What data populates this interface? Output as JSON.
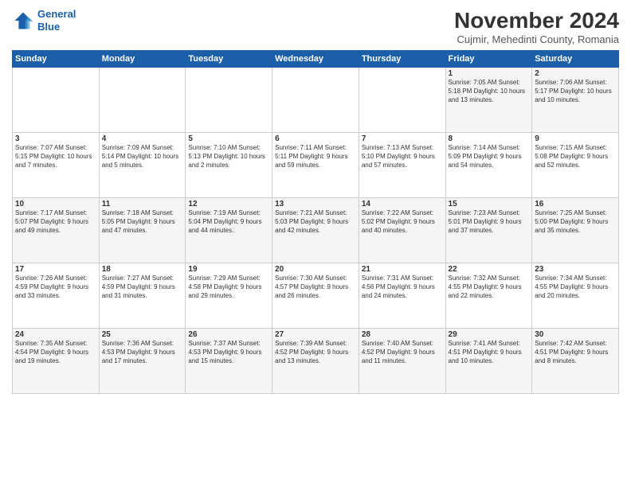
{
  "header": {
    "logo_line1": "General",
    "logo_line2": "Blue",
    "month": "November 2024",
    "location": "Cujmir, Mehedinti County, Romania"
  },
  "weekdays": [
    "Sunday",
    "Monday",
    "Tuesday",
    "Wednesday",
    "Thursday",
    "Friday",
    "Saturday"
  ],
  "weeks": [
    [
      {
        "day": "",
        "text": ""
      },
      {
        "day": "",
        "text": ""
      },
      {
        "day": "",
        "text": ""
      },
      {
        "day": "",
        "text": ""
      },
      {
        "day": "",
        "text": ""
      },
      {
        "day": "1",
        "text": "Sunrise: 7:05 AM\nSunset: 5:18 PM\nDaylight: 10 hours\nand 13 minutes."
      },
      {
        "day": "2",
        "text": "Sunrise: 7:06 AM\nSunset: 5:17 PM\nDaylight: 10 hours\nand 10 minutes."
      }
    ],
    [
      {
        "day": "3",
        "text": "Sunrise: 7:07 AM\nSunset: 5:15 PM\nDaylight: 10 hours\nand 7 minutes."
      },
      {
        "day": "4",
        "text": "Sunrise: 7:09 AM\nSunset: 5:14 PM\nDaylight: 10 hours\nand 5 minutes."
      },
      {
        "day": "5",
        "text": "Sunrise: 7:10 AM\nSunset: 5:13 PM\nDaylight: 10 hours\nand 2 minutes."
      },
      {
        "day": "6",
        "text": "Sunrise: 7:11 AM\nSunset: 5:11 PM\nDaylight: 9 hours\nand 59 minutes."
      },
      {
        "day": "7",
        "text": "Sunrise: 7:13 AM\nSunset: 5:10 PM\nDaylight: 9 hours\nand 57 minutes."
      },
      {
        "day": "8",
        "text": "Sunrise: 7:14 AM\nSunset: 5:09 PM\nDaylight: 9 hours\nand 54 minutes."
      },
      {
        "day": "9",
        "text": "Sunrise: 7:15 AM\nSunset: 5:08 PM\nDaylight: 9 hours\nand 52 minutes."
      }
    ],
    [
      {
        "day": "10",
        "text": "Sunrise: 7:17 AM\nSunset: 5:07 PM\nDaylight: 9 hours\nand 49 minutes."
      },
      {
        "day": "11",
        "text": "Sunrise: 7:18 AM\nSunset: 5:05 PM\nDaylight: 9 hours\nand 47 minutes."
      },
      {
        "day": "12",
        "text": "Sunrise: 7:19 AM\nSunset: 5:04 PM\nDaylight: 9 hours\nand 44 minutes."
      },
      {
        "day": "13",
        "text": "Sunrise: 7:21 AM\nSunset: 5:03 PM\nDaylight: 9 hours\nand 42 minutes."
      },
      {
        "day": "14",
        "text": "Sunrise: 7:22 AM\nSunset: 5:02 PM\nDaylight: 9 hours\nand 40 minutes."
      },
      {
        "day": "15",
        "text": "Sunrise: 7:23 AM\nSunset: 5:01 PM\nDaylight: 9 hours\nand 37 minutes."
      },
      {
        "day": "16",
        "text": "Sunrise: 7:25 AM\nSunset: 5:00 PM\nDaylight: 9 hours\nand 35 minutes."
      }
    ],
    [
      {
        "day": "17",
        "text": "Sunrise: 7:26 AM\nSunset: 4:59 PM\nDaylight: 9 hours\nand 33 minutes."
      },
      {
        "day": "18",
        "text": "Sunrise: 7:27 AM\nSunset: 4:59 PM\nDaylight: 9 hours\nand 31 minutes."
      },
      {
        "day": "19",
        "text": "Sunrise: 7:29 AM\nSunset: 4:58 PM\nDaylight: 9 hours\nand 29 minutes."
      },
      {
        "day": "20",
        "text": "Sunrise: 7:30 AM\nSunset: 4:57 PM\nDaylight: 9 hours\nand 26 minutes."
      },
      {
        "day": "21",
        "text": "Sunrise: 7:31 AM\nSunset: 4:56 PM\nDaylight: 9 hours\nand 24 minutes."
      },
      {
        "day": "22",
        "text": "Sunrise: 7:32 AM\nSunset: 4:55 PM\nDaylight: 9 hours\nand 22 minutes."
      },
      {
        "day": "23",
        "text": "Sunrise: 7:34 AM\nSunset: 4:55 PM\nDaylight: 9 hours\nand 20 minutes."
      }
    ],
    [
      {
        "day": "24",
        "text": "Sunrise: 7:35 AM\nSunset: 4:54 PM\nDaylight: 9 hours\nand 19 minutes."
      },
      {
        "day": "25",
        "text": "Sunrise: 7:36 AM\nSunset: 4:53 PM\nDaylight: 9 hours\nand 17 minutes."
      },
      {
        "day": "26",
        "text": "Sunrise: 7:37 AM\nSunset: 4:53 PM\nDaylight: 9 hours\nand 15 minutes."
      },
      {
        "day": "27",
        "text": "Sunrise: 7:39 AM\nSunset: 4:52 PM\nDaylight: 9 hours\nand 13 minutes."
      },
      {
        "day": "28",
        "text": "Sunrise: 7:40 AM\nSunset: 4:52 PM\nDaylight: 9 hours\nand 11 minutes."
      },
      {
        "day": "29",
        "text": "Sunrise: 7:41 AM\nSunset: 4:51 PM\nDaylight: 9 hours\nand 10 minutes."
      },
      {
        "day": "30",
        "text": "Sunrise: 7:42 AM\nSunset: 4:51 PM\nDaylight: 9 hours\nand 8 minutes."
      }
    ]
  ]
}
